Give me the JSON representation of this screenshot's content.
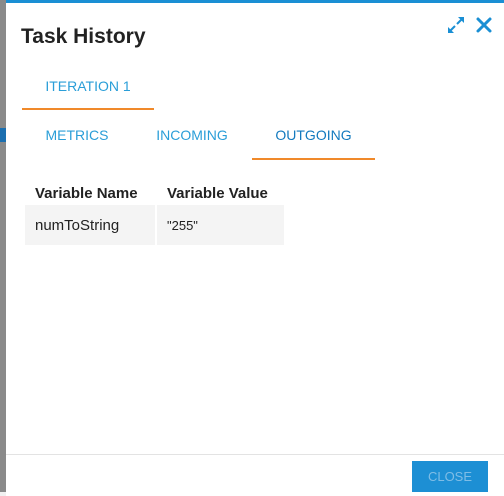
{
  "dialog": {
    "title": "Task History"
  },
  "iteration_tabs": [
    {
      "label": "ITERATION 1"
    }
  ],
  "detail_tabs": [
    {
      "label": "METRICS"
    },
    {
      "label": "INCOMING"
    },
    {
      "label": "OUTGOING",
      "selected": true
    }
  ],
  "table": {
    "headers": [
      "Variable Name",
      "Variable Value"
    ],
    "rows": [
      [
        "numToString",
        "\"255\""
      ]
    ]
  },
  "footer": {
    "close_label": "CLOSE"
  },
  "icons": {
    "expand": "expand-icon",
    "close": "close-icon"
  },
  "colors": {
    "accent_blue": "#1a8fd4",
    "tab_text": "#2a9ed8",
    "tab_underline": "#f0892a",
    "close_button": "#1d8fd4"
  }
}
